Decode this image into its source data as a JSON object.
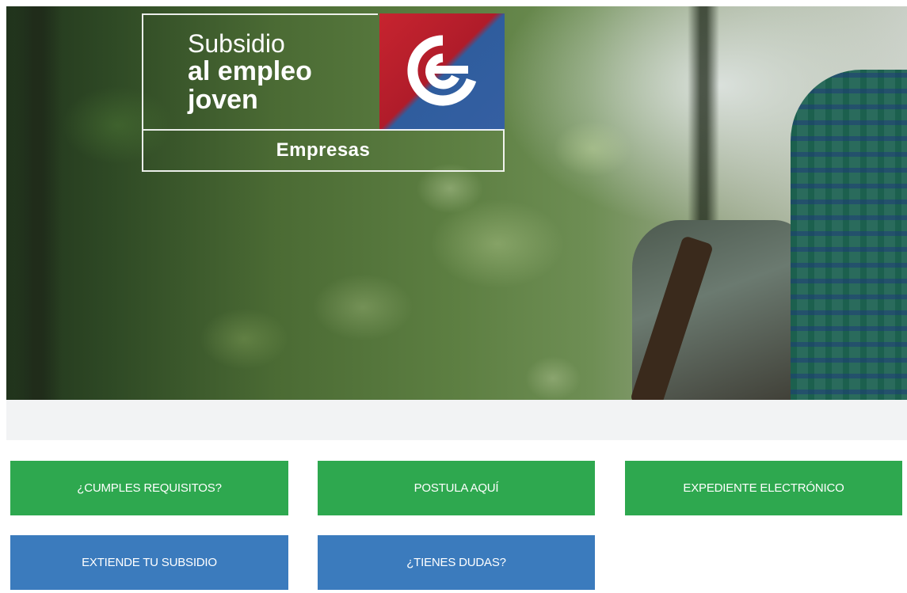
{
  "hero": {
    "logo": {
      "line1": "Subsidio",
      "line2": "al empleo",
      "line3": "joven",
      "subtitle": "Empresas",
      "emblem_icon": "e-letter-emblem-icon"
    }
  },
  "buttons": {
    "requisitos": "¿CUMPLES REQUISITOS?",
    "postula": "POSTULA AQUÍ",
    "expediente": "EXPEDIENTE ELECTRÓNICO",
    "extiende": "EXTIENDE TU SUBSIDIO",
    "dudas": "¿TIENES DUDAS?"
  },
  "colors": {
    "green": "#2ea84f",
    "blue": "#3b7bbd",
    "emblem_red": "#c7242f",
    "emblem_blue": "#355fa2"
  }
}
